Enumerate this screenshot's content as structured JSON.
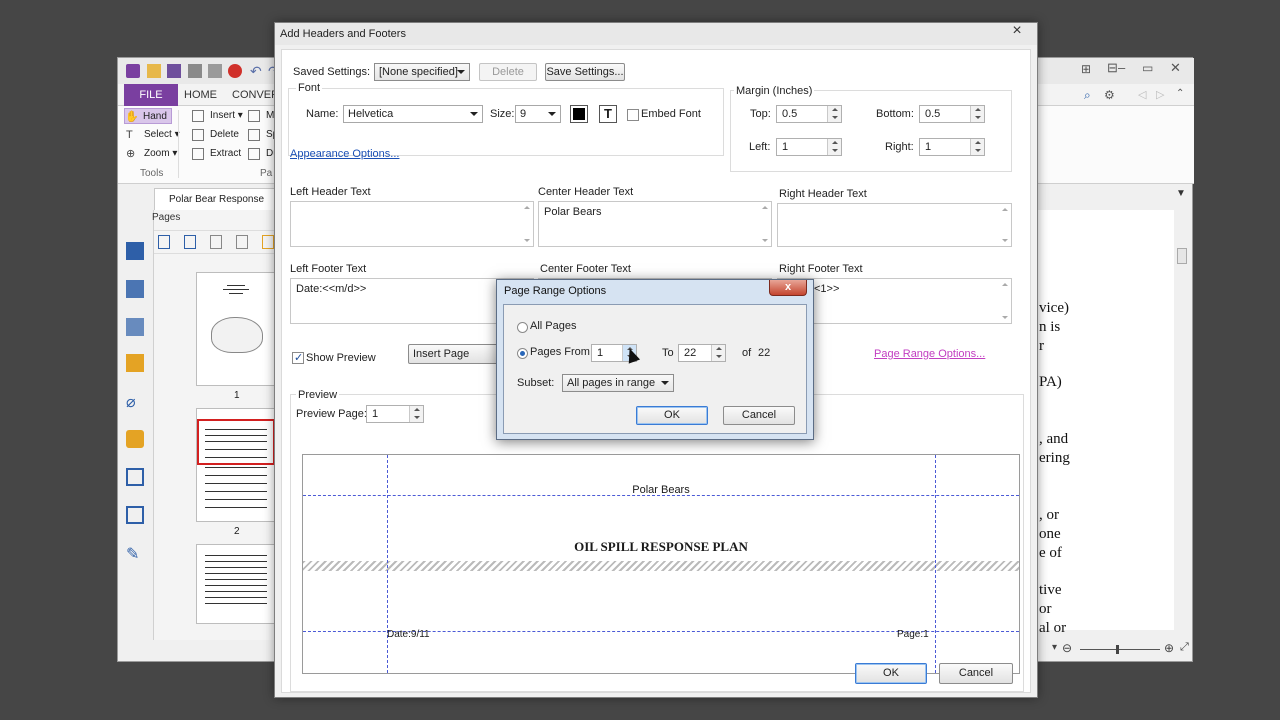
{
  "app": {
    "ribbon_tabs": {
      "file": "FILE",
      "home": "HOME",
      "convert": "CONVERT"
    },
    "tools": {
      "hand": "Hand",
      "select": "Select",
      "zoom": "Zoom",
      "insert": "Insert",
      "delete": "Delete",
      "extract": "Extract",
      "mo": "Mo",
      "sp": "Sp",
      "du": "Du",
      "group_tools": "Tools",
      "group_pa": "Pa"
    },
    "doc_tab": "Polar Bear Response Plan",
    "pages_label": "Pages",
    "thumb_numbers": [
      "1",
      "2"
    ],
    "doc_text": [
      "vice)",
      "n is",
      "r",
      "PA)",
      ", and",
      "ering",
      ", or",
      "one",
      "e of",
      "tive",
      "or",
      "al or"
    ]
  },
  "dialog": {
    "title": "Add Headers and Footers",
    "close": "×",
    "saved_settings_label": "Saved Settings:",
    "saved_settings_value": "[None specified]",
    "delete_button": "Delete",
    "save_settings_button": "Save Settings...",
    "font_legend": "Font",
    "name_label": "Name:",
    "font_name": "Helvetica",
    "size_label": "Size:",
    "font_size": "9",
    "embed_font": "Embed Font",
    "appearance_options": "Appearance Options...",
    "margin_legend": "Margin (Inches)",
    "margin": {
      "top_label": "Top:",
      "top": "0.5",
      "bottom_label": "Bottom:",
      "bottom": "0.5",
      "left_label": "Left:",
      "left": "1",
      "right_label": "Right:",
      "right": "1"
    },
    "left_header_label": "Left Header Text",
    "center_header_label": "Center Header Text",
    "right_header_label": "Right Header Text",
    "center_header_value": "Polar Bears",
    "left_footer_label": "Left Footer Text",
    "center_footer_label": "Center Footer Text",
    "right_footer_label": "Right Footer Text",
    "left_footer_value": "Date:<<m/d>>",
    "right_footer_value": "<1>>",
    "show_preview": "Show Preview",
    "insert_page_number": "Insert Page Numbe",
    "page_range_options": "Page Range Options...",
    "preview_legend": "Preview",
    "preview_page_label": "Preview Page:",
    "preview_page": "1",
    "preview": {
      "header_center": "Polar Bears",
      "doc_title": "OIL SPILL RESPONSE PLAN",
      "footer_left": "Date:9/11",
      "footer_right": "Page:1"
    },
    "ok": "OK",
    "cancel": "Cancel"
  },
  "page_range": {
    "title": "Page Range Options",
    "close": "x",
    "all_pages": "All Pages",
    "pages_from": "Pages From",
    "from": "1",
    "to_label": "To",
    "to": "22",
    "of_label": "of",
    "total": "22",
    "subset_label": "Subset:",
    "subset_value": "All pages in range",
    "ok": "OK",
    "cancel": "Cancel"
  }
}
